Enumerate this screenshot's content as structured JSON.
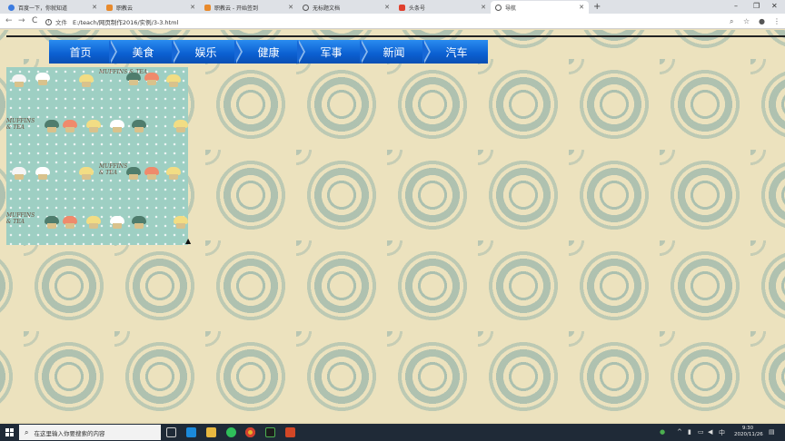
{
  "browser": {
    "tabs": [
      {
        "title": "百度一下，你就知道",
        "active": false,
        "icon": "paw-icon"
      },
      {
        "title": "职教云",
        "active": false,
        "icon": "cloud-icon"
      },
      {
        "title": "职教云 - 开始签到",
        "active": false,
        "icon": "cloud-icon"
      },
      {
        "title": "无标题文档",
        "active": false,
        "icon": "globe-icon"
      },
      {
        "title": "头条号",
        "active": false,
        "icon": "toutiao-icon"
      },
      {
        "title": "导航",
        "active": true,
        "icon": "globe-icon"
      }
    ],
    "new_tab": "+",
    "window_controls": {
      "minimize": "–",
      "restore": "❐",
      "close": "✕"
    },
    "address": {
      "scheme_label": "文件",
      "url": "E:/teach/网页制作2016/实例/3-3.html"
    },
    "nav": {
      "back": "←",
      "forward": "→",
      "reload": "C"
    },
    "tools": {
      "zoom": "⌕",
      "star": "☆",
      "profile": "●",
      "menu": "⋮"
    }
  },
  "page": {
    "menu": [
      "首页",
      "美食",
      "娱乐",
      "健康",
      "军事",
      "新闻",
      "汽车"
    ],
    "colors": {
      "menu_top": "#2a8cf0",
      "menu_bottom": "#0a4fb3",
      "pattern_bg": "#9ecfc3"
    },
    "image_text": "MUFFINS & TEA"
  },
  "taskbar": {
    "search_placeholder": "在这里输入你要搜索的内容",
    "time": "9:30",
    "date": "2020/11/26"
  }
}
